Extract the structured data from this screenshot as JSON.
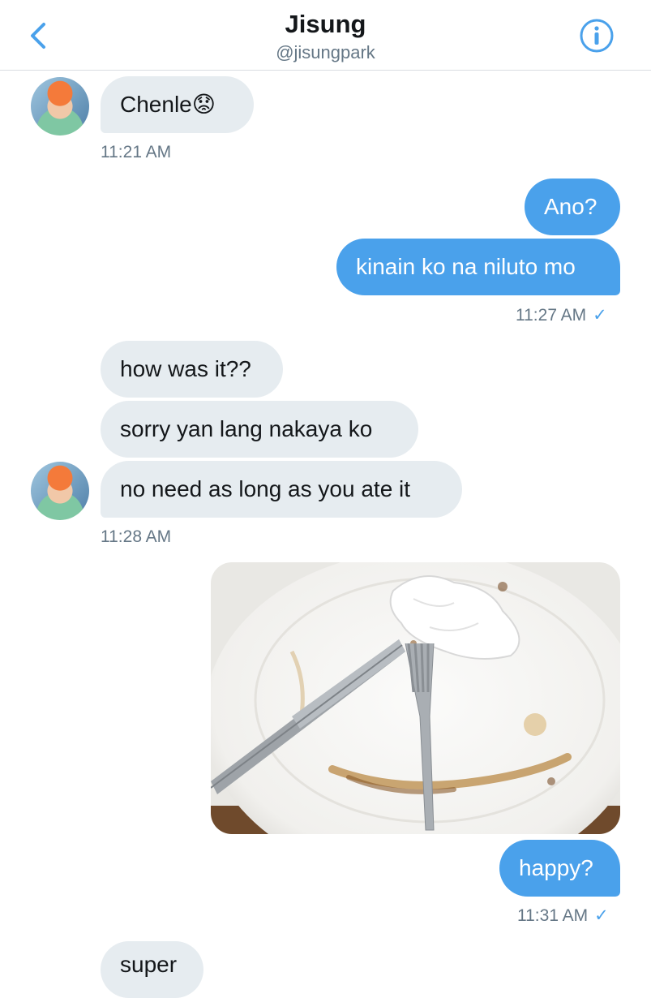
{
  "header": {
    "title": "Jisung",
    "handle": "@jisungpark"
  },
  "messages": {
    "m1": "Chenle😟",
    "t1": "11:21 AM",
    "m2": "Ano?",
    "m3": "kinain ko na niluto mo",
    "t2": "11:27 AM",
    "m4": "how was it??",
    "m5": "sorry yan lang nakaya ko",
    "m6": "no need as long as you ate it",
    "t3": "11:28 AM",
    "m7": "happy?",
    "t4": "11:31 AM",
    "m8": "super"
  },
  "icons": {
    "back": "chevron-left-icon",
    "info": "info-icon",
    "read": "checkmark-icon"
  },
  "colors": {
    "accent": "#4aa1eb",
    "incoming_bubble": "#e6ecf0",
    "text": "#14171a",
    "muted": "#657786"
  }
}
